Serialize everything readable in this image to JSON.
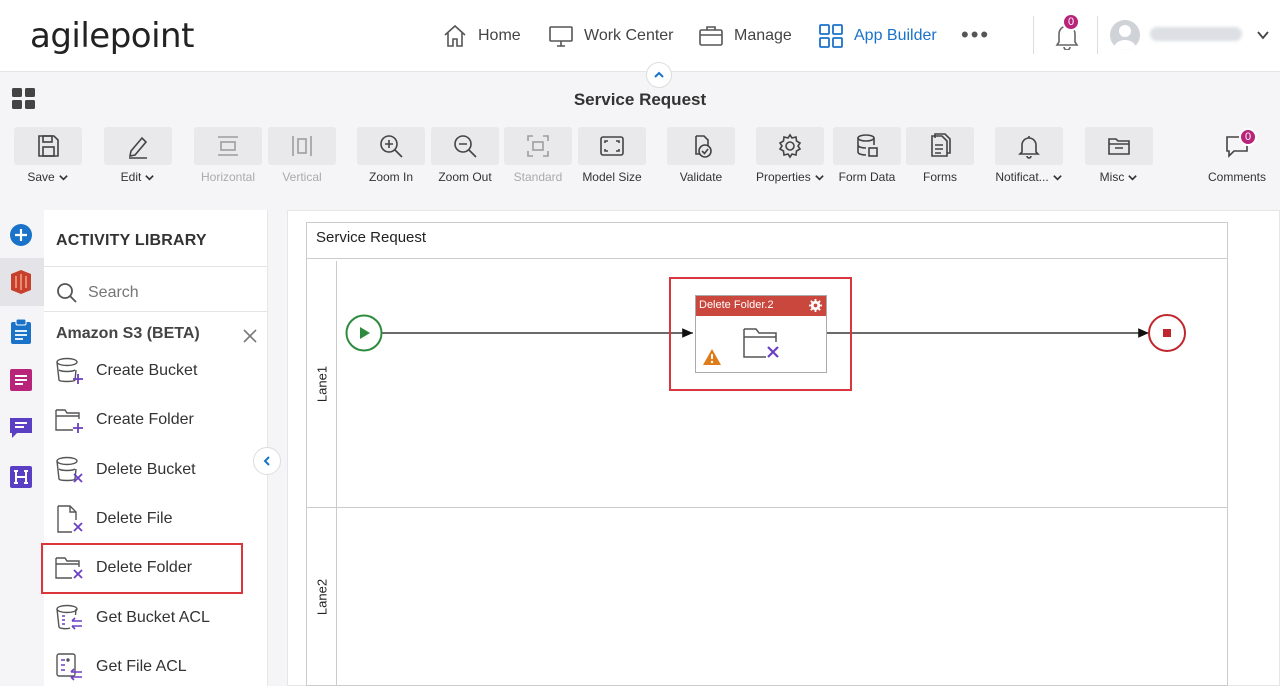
{
  "brand": {
    "logo_text": "agilepoint"
  },
  "nav": {
    "items": [
      {
        "label": "Home",
        "icon": "home-icon"
      },
      {
        "label": "Work Center",
        "icon": "monitor-icon"
      },
      {
        "label": "Manage",
        "icon": "briefcase-icon"
      },
      {
        "label": "App Builder",
        "icon": "grid-icon",
        "active": true
      }
    ],
    "more": "•••",
    "notifications_count": "0"
  },
  "page": {
    "title": "Service Request"
  },
  "toolbar": {
    "save": "Save",
    "edit": "Edit",
    "horizontal": "Horizontal",
    "vertical": "Vertical",
    "zoom_in": "Zoom In",
    "zoom_out": "Zoom Out",
    "standard": "Standard",
    "model_size": "Model Size",
    "validate": "Validate",
    "properties": "Properties",
    "form_data": "Form Data",
    "forms": "Forms",
    "notifications": "Notificat...",
    "misc": "Misc",
    "comments": "Comments",
    "comments_count": "0"
  },
  "library": {
    "title": "ACTIVITY LIBRARY",
    "search_placeholder": "Search",
    "category": "Amazon S3 (BETA)",
    "items": [
      {
        "label": "Create Bucket",
        "icon": "create-bucket-icon"
      },
      {
        "label": "Create Folder",
        "icon": "create-folder-icon"
      },
      {
        "label": "Delete Bucket",
        "icon": "delete-bucket-icon"
      },
      {
        "label": "Delete File",
        "icon": "delete-file-icon"
      },
      {
        "label": "Delete Folder",
        "icon": "delete-folder-icon",
        "highlighted": true
      },
      {
        "label": "Get Bucket ACL",
        "icon": "get-bucket-acl-icon"
      },
      {
        "label": "Get File ACL",
        "icon": "get-file-acl-icon"
      }
    ]
  },
  "process": {
    "pool_name": "Service Request",
    "lanes": [
      "Lane1",
      "Lane2"
    ],
    "task": {
      "title": "Delete Folder.2",
      "icon": "delete-folder-icon",
      "warning": true
    }
  },
  "colors": {
    "accent": "#1a73c8",
    "badge": "#b8247a",
    "highlight": "#d9373b",
    "task_header": "#c9473d",
    "start_event": "#2e8b3e",
    "end_event": "#c0262d",
    "activity_icon": "#6b3fc4"
  }
}
